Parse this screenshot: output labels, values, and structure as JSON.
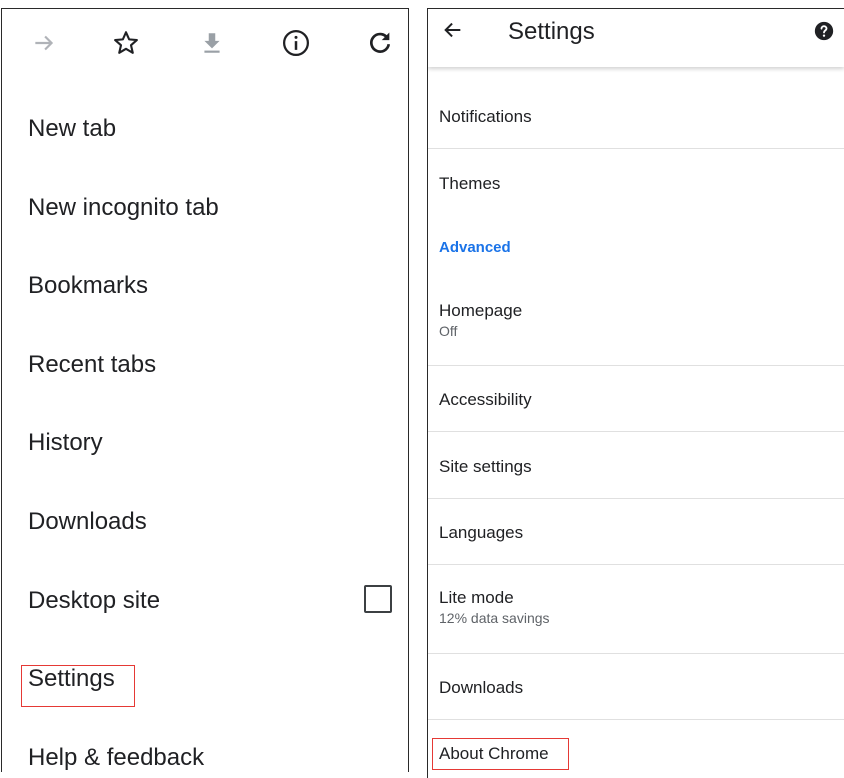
{
  "menu": {
    "toolbar_icons": [
      "forward-icon",
      "star-icon",
      "download-icon",
      "info-icon",
      "refresh-icon"
    ],
    "items": [
      {
        "label": "New tab"
      },
      {
        "label": "New incognito tab"
      },
      {
        "label": "Bookmarks"
      },
      {
        "label": "Recent tabs"
      },
      {
        "label": "History"
      },
      {
        "label": "Downloads"
      },
      {
        "label": "Desktop site",
        "checked": false
      },
      {
        "label": "Settings"
      },
      {
        "label": "Help & feedback"
      }
    ],
    "highlighted": "Settings"
  },
  "settings": {
    "title": "Settings",
    "back_icon": "back-arrow-icon",
    "help_icon": "help-icon",
    "section_header": "Advanced",
    "items": [
      {
        "title": "Notifications"
      },
      {
        "title": "Themes"
      },
      {
        "title": "Homepage",
        "subtitle": "Off"
      },
      {
        "title": "Accessibility"
      },
      {
        "title": "Site settings"
      },
      {
        "title": "Languages"
      },
      {
        "title": "Lite mode",
        "subtitle": "12% data savings"
      },
      {
        "title": "Downloads"
      },
      {
        "title": "About Chrome"
      }
    ],
    "highlighted": "About Chrome"
  },
  "colors": {
    "accent": "#1a73e8",
    "highlight_border": "#e53935",
    "disabled_icon": "#9aa0a6",
    "text": "#202124"
  }
}
